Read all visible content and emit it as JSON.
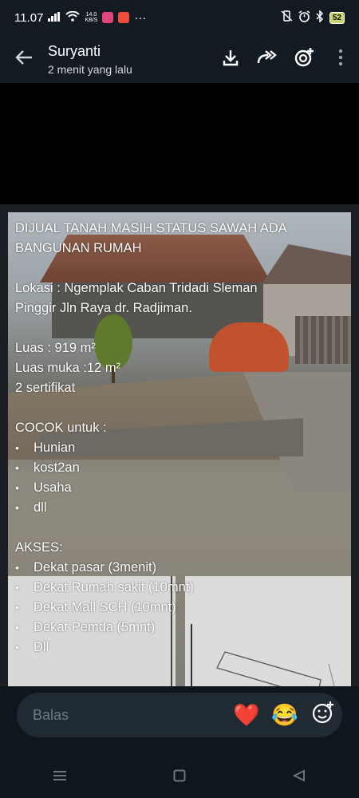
{
  "status_bar": {
    "time": "11.07",
    "net_speed_value": "14.0",
    "net_speed_unit": "KB/S",
    "more": "···",
    "battery": "52"
  },
  "header": {
    "sender": "Suryanti",
    "timestamp": "2 menit yang lalu",
    "icons": [
      "back-arrow-icon",
      "download-icon",
      "forward-icon",
      "camera-add-icon",
      "more-vert-icon"
    ]
  },
  "photo": {
    "title_line1": "DIJUAL TANAH MASIH STATUS SAWAH ADA",
    "title_line2": "BANGUNAN RUMAH",
    "location_line1": "Lokasi : Ngemplak Caban Tridadi Sleman",
    "location_line2": "Pinggir Jln Raya dr. Radjiman.",
    "luas": "Luas : 919 m²",
    "luas_muka": "Luas muka :12 m²",
    "sertifikat": "2 sertifikat",
    "cocok_heading": "COCOK untuk :",
    "cocok_items": [
      "Hunian",
      "kost2an",
      "Usaha",
      "dll"
    ],
    "akses_heading": "AKSES:",
    "akses_items": [
      "Dekat pasar (3menit)",
      "Dekat Rumah sakit (10mnt)",
      "Dekat Mall SCH (10mnt)",
      "Dekat Pemda (5mnt)",
      "Dll"
    ]
  },
  "reply": {
    "placeholder": "Balas",
    "emoji_heart": "❤️",
    "emoji_laugh": "😂"
  },
  "colors": {
    "bar_bg": "#121a22",
    "reply_box": "#1f2a33",
    "tarp": "#c0532e"
  }
}
